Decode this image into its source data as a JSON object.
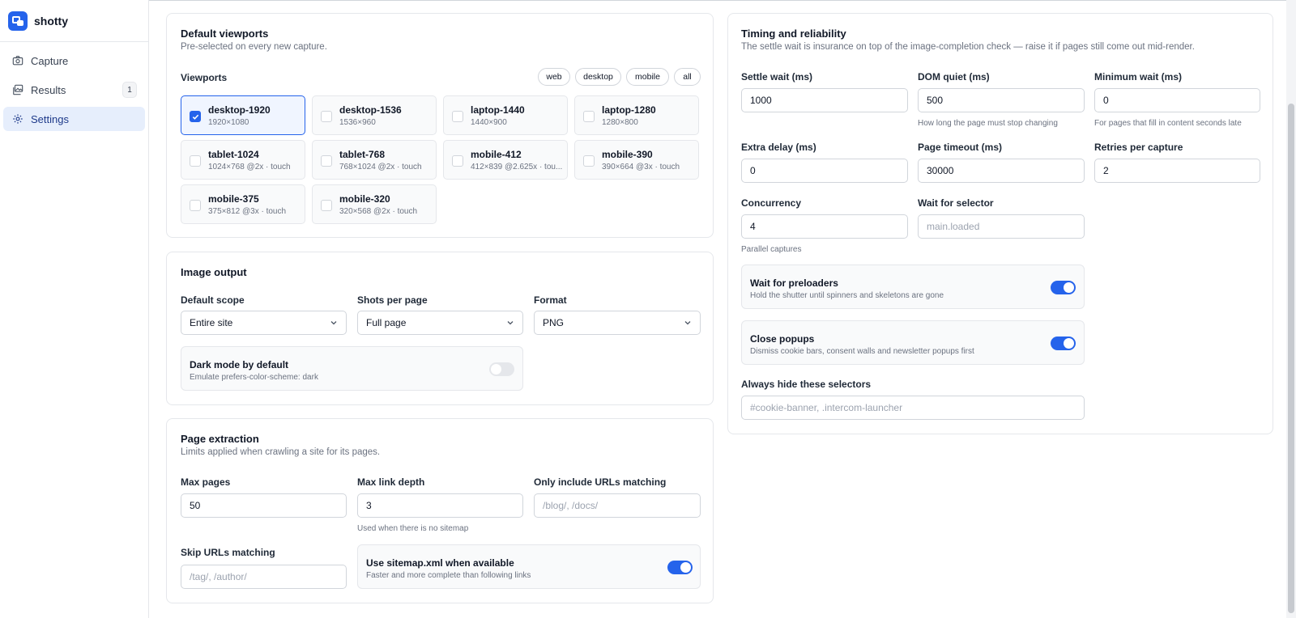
{
  "app": {
    "name": "shotty"
  },
  "sidebar": {
    "items": [
      {
        "label": "Capture",
        "icon": "camera-icon"
      },
      {
        "label": "Results",
        "icon": "images-icon",
        "badge": "1"
      },
      {
        "label": "Settings",
        "icon": "gear-icon",
        "active": true
      }
    ]
  },
  "viewports_card": {
    "title": "Default viewports",
    "subtitle": "Pre-selected on every new capture.",
    "label": "Viewports",
    "filters": [
      "web",
      "desktop",
      "mobile",
      "all"
    ],
    "items": [
      {
        "name": "desktop-1920",
        "detail": "1920×1080",
        "checked": true
      },
      {
        "name": "desktop-1536",
        "detail": "1536×960",
        "checked": false
      },
      {
        "name": "laptop-1440",
        "detail": "1440×900",
        "checked": false
      },
      {
        "name": "laptop-1280",
        "detail": "1280×800",
        "checked": false
      },
      {
        "name": "tablet-1024",
        "detail": "1024×768 @2x · touch",
        "checked": false
      },
      {
        "name": "tablet-768",
        "detail": "768×1024 @2x · touch",
        "checked": false
      },
      {
        "name": "mobile-412",
        "detail": "412×839 @2.625x · tou...",
        "checked": false
      },
      {
        "name": "mobile-390",
        "detail": "390×664 @3x · touch",
        "checked": false
      },
      {
        "name": "mobile-375",
        "detail": "375×812 @3x · touch",
        "checked": false
      },
      {
        "name": "mobile-320",
        "detail": "320×568 @2x · touch",
        "checked": false
      }
    ]
  },
  "image_output": {
    "title": "Image output",
    "scope": {
      "label": "Default scope",
      "value": "Entire site"
    },
    "shots": {
      "label": "Shots per page",
      "value": "Full page"
    },
    "format": {
      "label": "Format",
      "value": "PNG"
    },
    "dark_mode": {
      "title": "Dark mode by default",
      "desc": "Emulate prefers-color-scheme: dark",
      "on": false
    }
  },
  "page_extraction": {
    "title": "Page extraction",
    "subtitle": "Limits applied when crawling a site for its pages.",
    "max_pages": {
      "label": "Max pages",
      "value": "50"
    },
    "max_depth": {
      "label": "Max link depth",
      "value": "3",
      "hint": "Used when there is no sitemap"
    },
    "include": {
      "label": "Only include URLs matching",
      "placeholder": "/blog/, /docs/"
    },
    "skip": {
      "label": "Skip URLs matching",
      "placeholder": "/tag/, /author/"
    },
    "sitemap": {
      "title": "Use sitemap.xml when available",
      "desc": "Faster and more complete than following links",
      "on": true
    }
  },
  "timing": {
    "title": "Timing and reliability",
    "subtitle": "The settle wait is insurance on top of the image-completion check — raise it if pages still come out mid-render.",
    "settle": {
      "label": "Settle wait (ms)",
      "value": "1000"
    },
    "dom_quiet": {
      "label": "DOM quiet (ms)",
      "value": "500",
      "hint": "How long the page must stop changing"
    },
    "min_wait": {
      "label": "Minimum wait (ms)",
      "value": "0",
      "hint": "For pages that fill in content seconds late"
    },
    "extra_delay": {
      "label": "Extra delay (ms)",
      "value": "0"
    },
    "page_timeout": {
      "label": "Page timeout (ms)",
      "value": "30000"
    },
    "retries": {
      "label": "Retries per capture",
      "value": "2"
    },
    "concurrency": {
      "label": "Concurrency",
      "value": "4",
      "hint": "Parallel captures"
    },
    "wait_selector": {
      "label": "Wait for selector",
      "placeholder": "main.loaded"
    },
    "preloaders": {
      "title": "Wait for preloaders",
      "desc": "Hold the shutter until spinners and skeletons are gone",
      "on": true
    },
    "popups": {
      "title": "Close popups",
      "desc": "Dismiss cookie bars, consent walls and newsletter popups first",
      "on": true
    },
    "hide_selectors": {
      "label": "Always hide these selectors",
      "placeholder": "#cookie-banner, .intercom-launcher"
    }
  },
  "colors": {
    "accent": "#2563eb",
    "border": "#e5e7eb",
    "muted": "#6b7280"
  }
}
